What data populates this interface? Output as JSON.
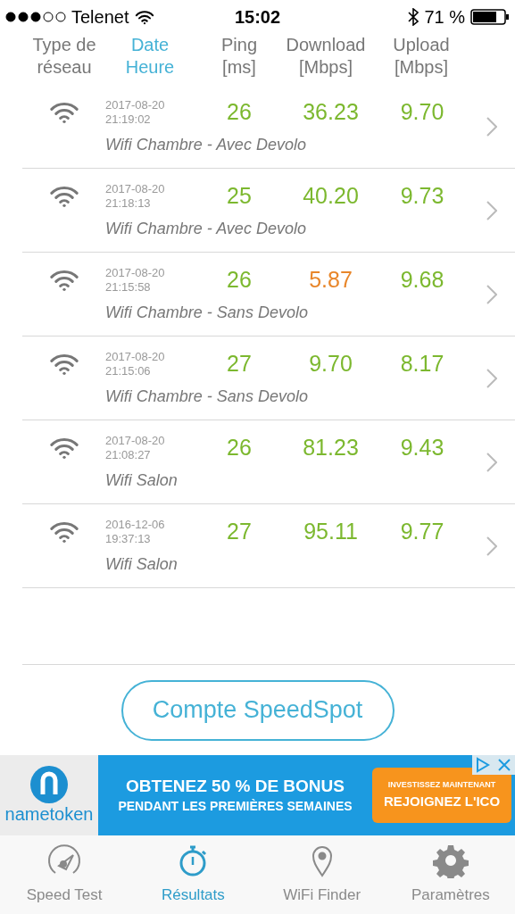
{
  "status_bar": {
    "carrier": "Telenet",
    "time": "15:02",
    "battery": "71 %"
  },
  "columns": [
    {
      "label": "Type de réseau",
      "selected": false
    },
    {
      "label": "Date Heure",
      "selected": true
    },
    {
      "label": "Ping [ms]",
      "selected": false
    },
    {
      "label": "Download [Mbps]",
      "selected": false
    },
    {
      "label": "Upload [Mbps]",
      "selected": false
    }
  ],
  "rows": [
    {
      "date": "2017-08-20",
      "time": "21:19:02",
      "ping": "26",
      "download": {
        "value": "36.23",
        "color": "#7cb82f"
      },
      "upload": "9.70",
      "name": "Wifi Chambre - Avec Devolo"
    },
    {
      "date": "2017-08-20",
      "time": "21:18:13",
      "ping": "25",
      "download": {
        "value": "40.20",
        "color": "#7cb82f"
      },
      "upload": "9.73",
      "name": "Wifi Chambre - Avec Devolo"
    },
    {
      "date": "2017-08-20",
      "time": "21:15:58",
      "ping": "26",
      "download": {
        "value": "5.87",
        "color": "#e8862a"
      },
      "upload": "9.68",
      "name": "Wifi Chambre - Sans Devolo"
    },
    {
      "date": "2017-08-20",
      "time": "21:15:06",
      "ping": "27",
      "download": {
        "value": "9.70",
        "color": "#7cb82f"
      },
      "upload": "8.17",
      "name": "Wifi Chambre - Sans Devolo"
    },
    {
      "date": "2017-08-20",
      "time": "21:08:27",
      "ping": "26",
      "download": {
        "value": "81.23",
        "color": "#7cb82f"
      },
      "upload": "9.43",
      "name": "Wifi Salon"
    },
    {
      "date": "2016-12-06",
      "time": "19:37:13",
      "ping": "27",
      "download": {
        "value": "95.11",
        "color": "#7cb82f"
      },
      "upload": "9.77",
      "name": "Wifi Salon"
    }
  ],
  "account_button": "Compte SpeedSpot",
  "ad": {
    "brand": "nametoken",
    "headline": "OBTENEZ 50 % DE BONUS",
    "subline": "PENDANT LES PREMIÈRES SEMAINES",
    "cta_top": "INVESTISSEZ MAINTENANT",
    "cta": "REJOIGNEZ L'ICO"
  },
  "tabs": [
    {
      "kind": "speed",
      "label": "Speed Test",
      "selected": false
    },
    {
      "kind": "results",
      "label": "Résultats",
      "selected": true
    },
    {
      "kind": "finder",
      "label": "WiFi Finder",
      "selected": false
    },
    {
      "kind": "settings",
      "label": "Paramètres",
      "selected": false
    }
  ]
}
